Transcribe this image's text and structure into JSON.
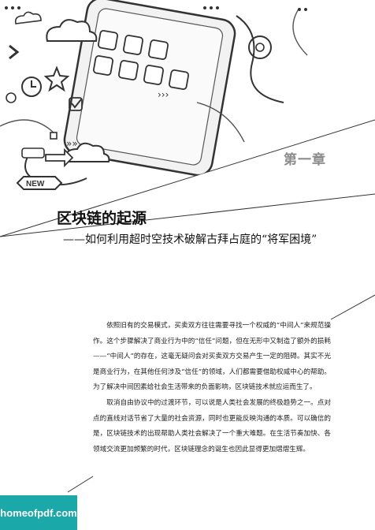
{
  "chapter_label": "第一章",
  "title": "区块链的起源",
  "subtitle": "——如何利用超时空技术破解古拜占庭的“将军困境”",
  "illustration": {
    "badge_text": "NEW",
    "arrows_text": "»»",
    "arrows_right_text": "›››",
    "icons": [
      "cloud-icon",
      "star-icon",
      "gear-icon",
      "checkbox-icon",
      "clock-icon",
      "phone-illustration"
    ]
  },
  "paragraphs": [
    "依照旧有的交易模式，买卖双方往往需要寻找一个权威的“中间人”来规范操作。这个步骤解决了商业行为中的“信任”问题，但在无形中又制造了额外的损耗——“中间人”的存在，这毫无疑问会对买卖双方交易产生一定的阻碍。其实不光是商业行为，在其他任何涉及“信任”的领域，人们都需要借助权威中心的帮助。为了解决中间因素给社会生活带来的负面影响，区块链技术就应运而生了。",
    "取消自由协议中的过渡环节，可以说是人类社会发展的终极趋势之一。点对点的直线对话节省了大量的社会资源，同时也更能反映沟通的本质。可以确信的是，区块链技术的出现帮助人类社会解决了一个重大难题。在生活节奏加快、各领域交流更加频繁的时代，区块链理念的诞生也因此显得更加熠熠生辉。"
  ],
  "watermark": "homeofpdf.com",
  "colors": {
    "chapter": "#8c8c8c",
    "watermark_bg": "#1aa8a8",
    "line": "#333333"
  }
}
